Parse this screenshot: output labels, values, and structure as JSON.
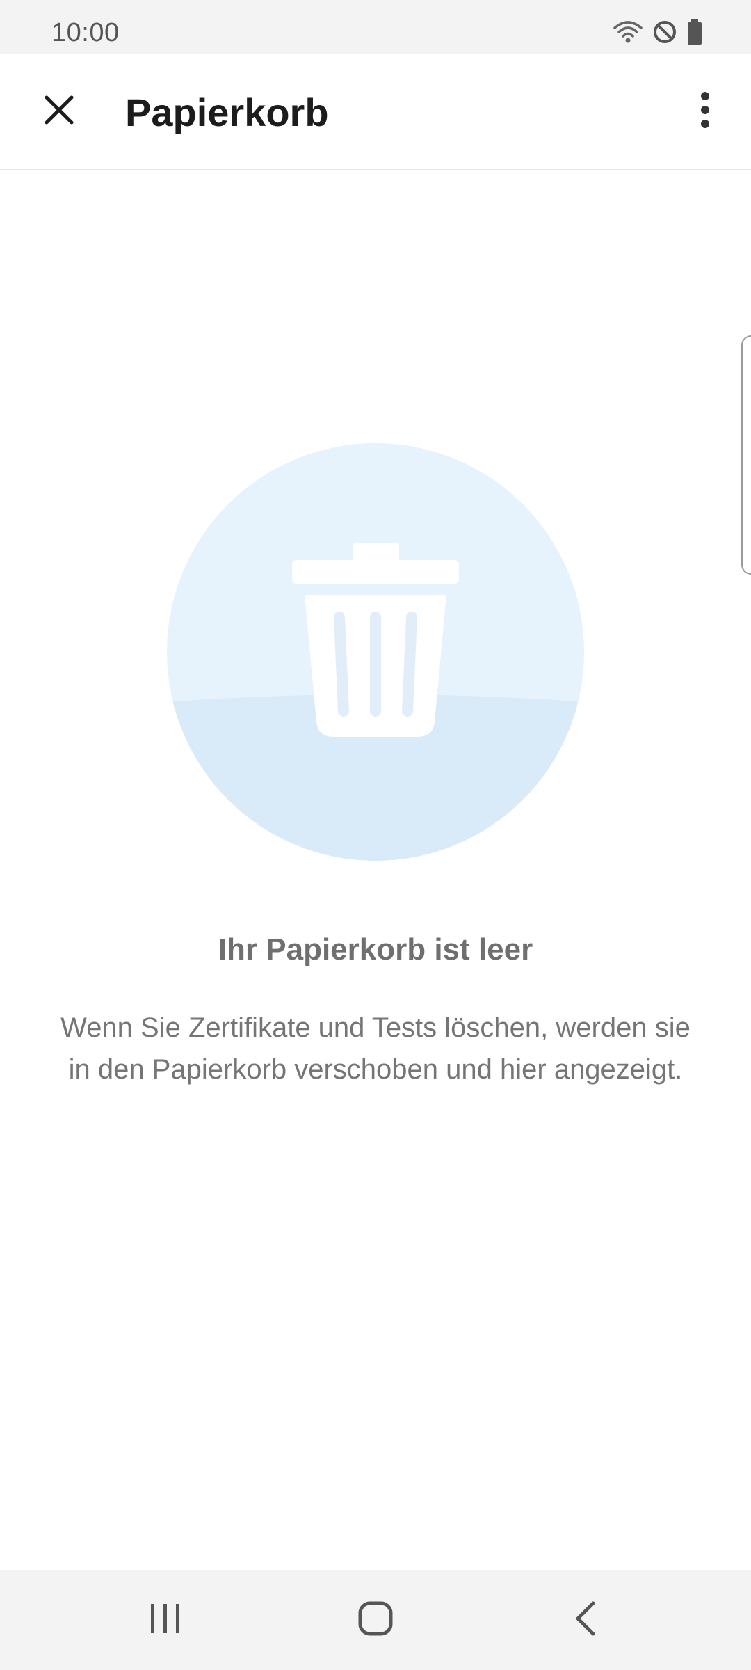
{
  "status_bar": {
    "time": "10:00",
    "icons": [
      "wifi-icon",
      "do-not-disturb-icon",
      "battery-icon"
    ]
  },
  "app_bar": {
    "title": "Papierkorb",
    "close_icon": "close-icon",
    "menu_icon": "more-vert-icon"
  },
  "empty_state": {
    "icon": "trash-can-icon",
    "title": "Ihr Papierkorb ist leer",
    "description": "Wenn Sie Zertifikate und Tests löschen, werden sie in den Papierkorb verschoben und hier angezeigt."
  },
  "nav_bar": {
    "icons": [
      "recent-apps-icon",
      "home-icon",
      "back-icon"
    ]
  },
  "colors": {
    "circle_top": "#e6f2fc",
    "circle_bottom": "#d9eaf8",
    "title_text": "#1c1c1c",
    "muted_text": "#757575"
  }
}
